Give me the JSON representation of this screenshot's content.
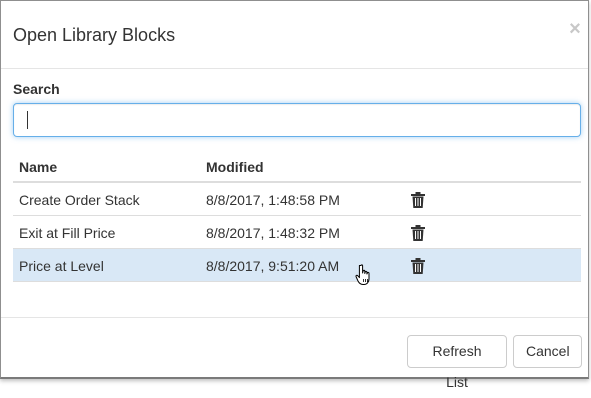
{
  "dialog": {
    "title": "Open Library Blocks",
    "close_glyph": "×"
  },
  "search": {
    "label": "Search",
    "value": "",
    "placeholder": ""
  },
  "table": {
    "headers": [
      "Name",
      "Modified"
    ],
    "rows": [
      {
        "name": "Create Order Stack",
        "modified": "8/8/2017, 1:48:58 PM",
        "selected": false
      },
      {
        "name": "Exit at Fill Price",
        "modified": "8/8/2017, 1:48:32 PM",
        "selected": false
      },
      {
        "name": "Price at Level",
        "modified": "8/8/2017, 9:51:20 AM",
        "selected": true
      }
    ],
    "row_action_icon": "trash-icon"
  },
  "footer": {
    "refresh_label": "Refresh List",
    "cancel_label": "Cancel"
  },
  "colors": {
    "selected_row": "#d9e8f6",
    "input_focus_border": "#66afe9"
  }
}
